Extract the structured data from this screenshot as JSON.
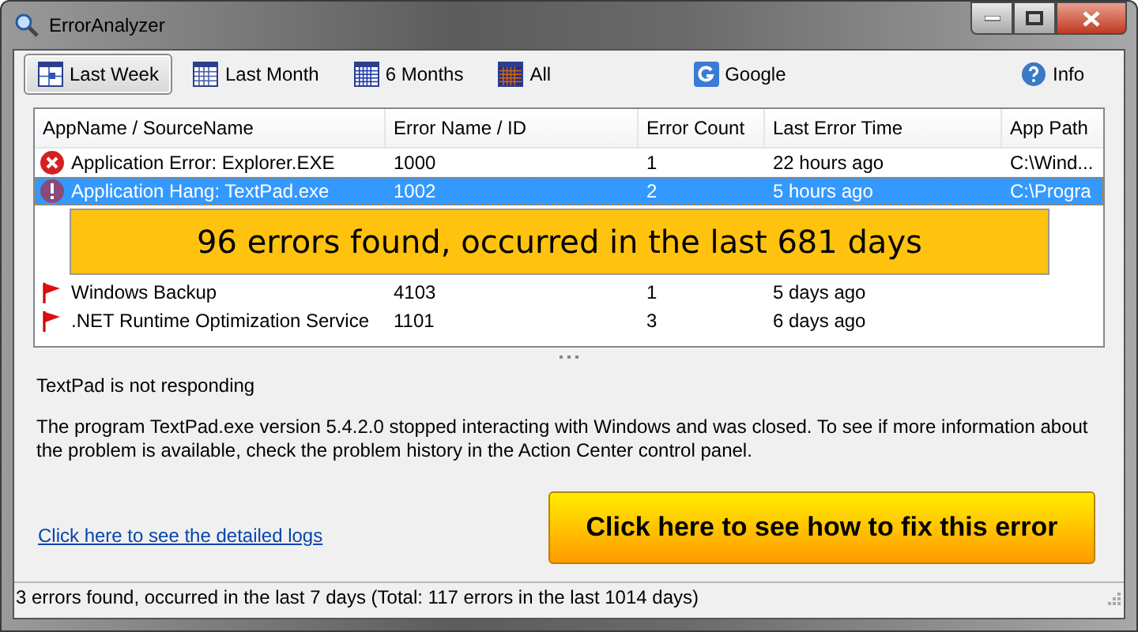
{
  "window": {
    "title": "ErrorAnalyzer"
  },
  "toolbar": [
    {
      "label": "Last Week",
      "kind": "week",
      "selected": true
    },
    {
      "label": "Last Month",
      "kind": "month",
      "selected": false
    },
    {
      "label": "6 Months",
      "kind": "half-year",
      "selected": false
    },
    {
      "label": "All",
      "kind": "all",
      "selected": false
    },
    {
      "label": "Google",
      "kind": "google",
      "selected": false
    },
    {
      "label": "Info",
      "kind": "info",
      "selected": false
    }
  ],
  "table": {
    "columns": [
      "AppName / SourceName",
      "Error Name / ID",
      "Error Count",
      "Last Error Time",
      "App Path"
    ],
    "rows": [
      {
        "kind": "error",
        "selected": false,
        "cells": [
          "Application Error: Explorer.EXE",
          "1000",
          "1",
          "22 hours ago",
          "C:\\Wind..."
        ]
      },
      {
        "kind": "hang",
        "selected": true,
        "cells": [
          "Application Hang: TextPad.exe",
          "1002",
          "2",
          "5 hours ago",
          "C:\\Progra"
        ]
      },
      {
        "kind": "banner",
        "text": "96 errors found, occurred in the last 681 days"
      },
      {
        "kind": "flag",
        "selected": false,
        "cells": [
          "Windows Backup",
          "4103",
          "1",
          "5 days ago"
        ]
      },
      {
        "kind": "flag",
        "selected": false,
        "cells": [
          ".NET Runtime Optimization Service",
          "1101",
          "3",
          "6 days ago"
        ]
      }
    ]
  },
  "details": {
    "title": "TextPad is not responding",
    "message": "The program TextPad.exe version 5.4.2.0 stopped interacting with Windows and was closed. To see if more information about the problem is available, check the problem history in the Action Center control panel.",
    "link": "Click here to see the detailed logs",
    "fix_button": "Click here to see how to fix this error"
  },
  "status_bar": {
    "text": "3 errors found, occurred in the last 7 days (Total: 117 errors in the last 1014 days)"
  }
}
